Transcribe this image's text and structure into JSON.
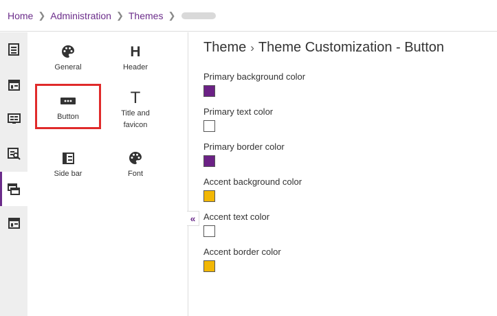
{
  "breadcrumb": {
    "items": [
      "Home",
      "Administration",
      "Themes"
    ]
  },
  "rail": {
    "items": [
      {
        "icon": "document-list-icon"
      },
      {
        "icon": "layout-icon"
      },
      {
        "icon": "display-icon"
      },
      {
        "icon": "search-list-icon"
      },
      {
        "icon": "theme-windows-icon",
        "active": true
      },
      {
        "icon": "layout-icon"
      }
    ]
  },
  "menu": {
    "general": "General",
    "header": "Header",
    "button": "Button",
    "title_favicon_line1": "Title and",
    "title_favicon_line2": "favicon",
    "sidebar": "Side bar",
    "font": "Font"
  },
  "main": {
    "title_part1": "Theme",
    "title_part2": "Theme Customization - Button",
    "fields": [
      {
        "label": "Primary background color",
        "color": "#6b2185"
      },
      {
        "label": "Primary text color",
        "color": "#ffffff"
      },
      {
        "label": "Primary border color",
        "color": "#6b2185"
      },
      {
        "label": "Accent background color",
        "color": "#f2b705"
      },
      {
        "label": "Accent text color",
        "color": "#ffffff"
      },
      {
        "label": "Accent border color",
        "color": "#f2b705"
      }
    ]
  },
  "colors": {
    "accent": "#6b2c8a",
    "highlight": "#e02a2a"
  }
}
